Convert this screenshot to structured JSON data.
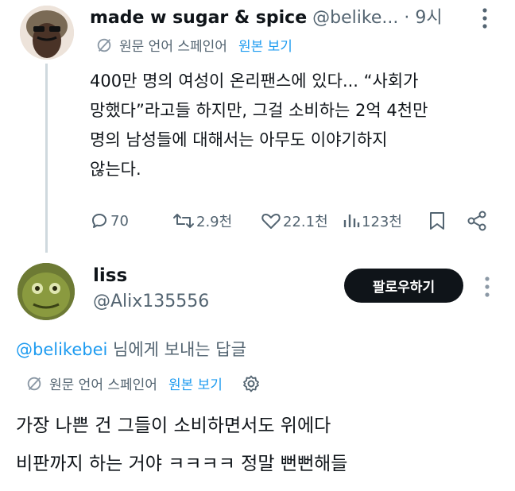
{
  "tweet": {
    "author_name": "made w sugar & spice",
    "author_handle": "@belike...",
    "separator": "·",
    "time": "9시",
    "more_icon": "more-dots-icon",
    "translate": {
      "source_text": "원문 언어 스페인어",
      "show_original": "원본 보기"
    },
    "body_lines": [
      "400만 명의 여성이 온리팬스에 있다... “사회가",
      "망했다”라고들 하지만, 그걸 소비하는 2억 4천만",
      "명의 남성들에 대해서는 아무도 이야기하지",
      "않는다."
    ],
    "stats": {
      "replies": "70",
      "reposts": "2.9천",
      "likes": "22.1천",
      "views": "123천"
    }
  },
  "reply": {
    "author_name": "liss",
    "author_handle": "@Alix135556",
    "follow_label": "팔로우하기",
    "reply_to_handle": "@belikebei",
    "reply_to_suffix": " 님에게 보내는 답글",
    "translate": {
      "source_text": "원문 언어 스페인어",
      "show_original": "원본 보기"
    },
    "body_lines": [
      "가장 나쁜 건 그들이 소비하면서도 위에다",
      "비판까지 하는 거야 ㅋㅋㅋㅋ 정말 뻔뻔해들"
    ]
  },
  "colors": {
    "accent": "#1d9bf0",
    "muted": "#536471",
    "text": "#0f1419",
    "button_bg": "#0f1419"
  }
}
